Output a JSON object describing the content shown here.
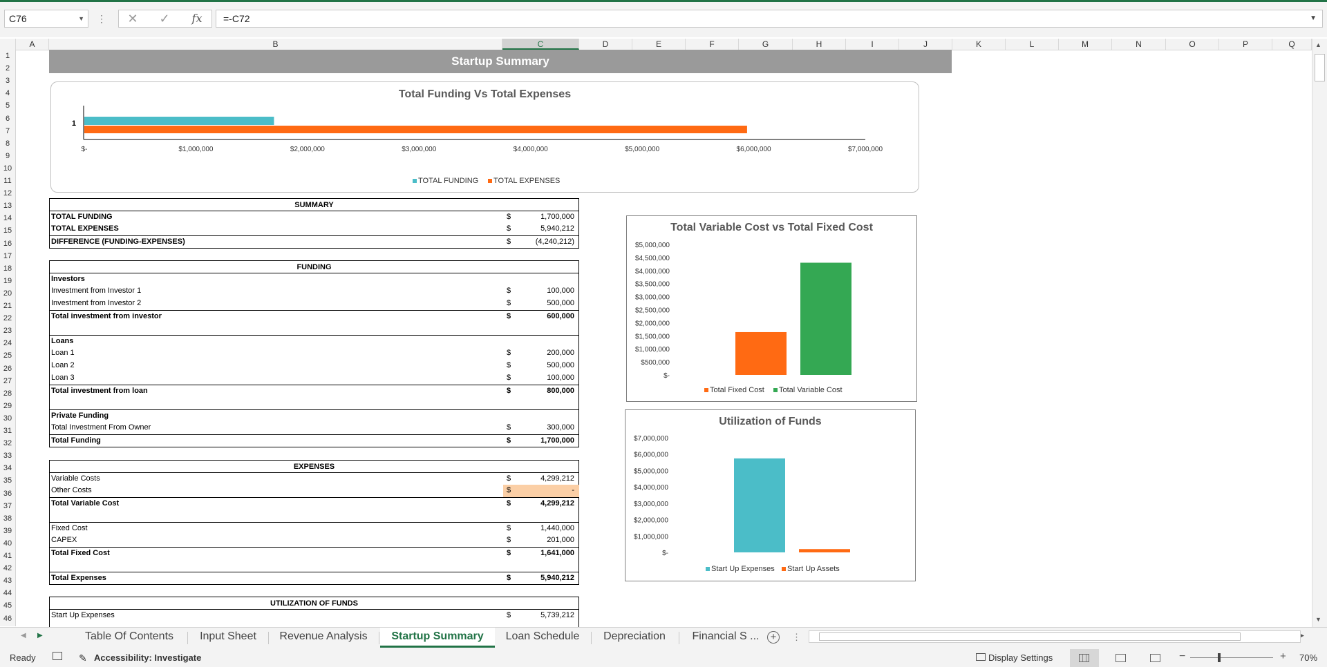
{
  "window": {
    "accent": "#217346"
  },
  "formula_bar": {
    "name_box": "C76",
    "formula": "=-C72",
    "cancel_icon": "✕",
    "enter_icon": "✓",
    "fx_icon": "fx"
  },
  "columns": [
    "A",
    "B",
    "C",
    "D",
    "E",
    "F",
    "G",
    "H",
    "I",
    "J",
    "K",
    "L",
    "M",
    "N",
    "O",
    "P",
    "Q"
  ],
  "rows": [
    "1",
    "2",
    "3",
    "4",
    "5",
    "6",
    "7",
    "8",
    "9",
    "10",
    "11",
    "12",
    "13",
    "14",
    "15",
    "16",
    "17",
    "18",
    "19",
    "20",
    "21",
    "22",
    "23",
    "24",
    "25",
    "26",
    "27",
    "28",
    "29",
    "30",
    "31",
    "32",
    "33",
    "34",
    "35",
    "36",
    "37",
    "38",
    "39",
    "40",
    "41",
    "42",
    "43",
    "44",
    "45",
    "46"
  ],
  "sheet": {
    "title": "Startup Summary",
    "summary": {
      "header": "SUMMARY",
      "rows": [
        {
          "label": "TOTAL FUNDING",
          "cur": "$",
          "value": "1,700,000"
        },
        {
          "label": "TOTAL EXPENSES",
          "cur": "$",
          "value": "5,940,212"
        },
        {
          "label": "DIFFERENCE (FUNDING-EXPENSES)",
          "cur": "$",
          "value": "(4,240,212)"
        }
      ]
    },
    "funding": {
      "header": "FUNDING",
      "investors_label": "Investors",
      "inv1": {
        "label": "Investment from Investor 1",
        "cur": "$",
        "value": "100,000"
      },
      "inv2": {
        "label": "Investment from Investor 2",
        "cur": "$",
        "value": "500,000"
      },
      "inv_total": {
        "label": "Total investment from investor",
        "cur": "$",
        "value": "600,000"
      },
      "loans_label": "Loans",
      "loan1": {
        "label": "Loan 1",
        "cur": "$",
        "value": "200,000"
      },
      "loan2": {
        "label": "Loan 2",
        "cur": "$",
        "value": "500,000"
      },
      "loan3": {
        "label": "Loan 3",
        "cur": "$",
        "value": "100,000"
      },
      "loan_total": {
        "label": "Total investment from loan",
        "cur": "$",
        "value": "800,000"
      },
      "private_label": "Private Funding",
      "owner": {
        "label": "Total Investment From Owner",
        "cur": "$",
        "value": "300,000"
      },
      "total": {
        "label": "Total Funding",
        "cur": "$",
        "value": "1,700,000"
      }
    },
    "expenses": {
      "header": "EXPENSES",
      "variable": {
        "label": "Variable Costs",
        "cur": "$",
        "value": "4,299,212"
      },
      "other": {
        "label": "Other Costs",
        "cur": "$",
        "value": "-"
      },
      "total_variable": {
        "label": "Total Variable Cost",
        "cur": "$",
        "value": "4,299,212"
      },
      "fixed": {
        "label": "Fixed Cost",
        "cur": "$",
        "value": "1,440,000"
      },
      "capex": {
        "label": "CAPEX",
        "cur": "$",
        "value": "201,000"
      },
      "total_fixed": {
        "label": "Total Fixed Cost",
        "cur": "$",
        "value": "1,641,000"
      },
      "total_expenses": {
        "label": "Total Expenses",
        "cur": "$",
        "value": "5,940,212"
      }
    },
    "utilization": {
      "header": "UTILIZATION OF FUNDS",
      "startup": {
        "label": "Start Up Expenses",
        "cur": "$",
        "value": "5,739,212"
      }
    }
  },
  "chart_data": [
    {
      "type": "bar",
      "title": "Total Funding Vs Total Expenses",
      "orientation": "horizontal",
      "categories": [
        "1"
      ],
      "series": [
        {
          "name": "TOTAL FUNDING",
          "values": [
            1700000
          ],
          "color": "#4bbdc8"
        },
        {
          "name": "TOTAL EXPENSES",
          "values": [
            5940212
          ],
          "color": "#ff6a13"
        }
      ],
      "xlim": [
        0,
        7000000
      ],
      "tick_labels": [
        "$-",
        "$1,000,000",
        "$2,000,000",
        "$3,000,000",
        "$4,000,000",
        "$5,000,000",
        "$6,000,000",
        "$7,000,000"
      ],
      "legend": "bottom"
    },
    {
      "type": "bar",
      "title": "Total Variable Cost vs Total Fixed Cost",
      "categories": [
        ""
      ],
      "series": [
        {
          "name": "Total Fixed Cost",
          "values": [
            1641000
          ],
          "color": "#ff6a13"
        },
        {
          "name": "Total Variable Cost",
          "values": [
            4299212
          ],
          "color": "#34a853"
        }
      ],
      "ylim": [
        0,
        5000000
      ],
      "tick_labels": [
        "$-",
        "$500,000",
        "$1,000,000",
        "$1,500,000",
        "$2,000,000",
        "$2,500,000",
        "$3,000,000",
        "$3,500,000",
        "$4,000,000",
        "$4,500,000",
        "$5,000,000"
      ],
      "legend": "bottom"
    },
    {
      "type": "bar",
      "title": "Utilization of Funds",
      "categories": [
        ""
      ],
      "series": [
        {
          "name": "Start Up Expenses",
          "values": [
            5739212
          ],
          "color": "#4bbdc8"
        },
        {
          "name": "Start Up Assets",
          "values": [
            201000
          ],
          "color": "#ff6a13"
        }
      ],
      "ylim": [
        0,
        7000000
      ],
      "tick_labels": [
        "$-",
        "$1,000,000",
        "$2,000,000",
        "$3,000,000",
        "$4,000,000",
        "$5,000,000",
        "$6,000,000",
        "$7,000,000"
      ],
      "legend": "bottom"
    }
  ],
  "tabs": [
    "Table Of Contents",
    "Input Sheet",
    "Revenue Analysis",
    "Startup Summary",
    "Loan Schedule",
    "Depreciation",
    "Financial S ..."
  ],
  "active_tab": "Startup Summary",
  "status": {
    "ready": "Ready",
    "accessibility": "Accessibility: Investigate",
    "display_settings": "Display Settings",
    "zoom": "70%"
  }
}
